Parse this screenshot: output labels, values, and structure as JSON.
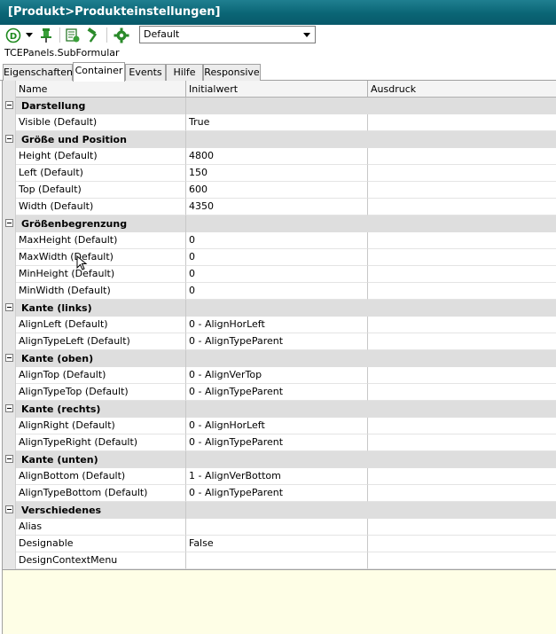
{
  "window": {
    "title": "[Produkt>Produkteinstellungen]"
  },
  "toolbar": {
    "icons": [
      "d-circle-icon",
      "dropdown-arrow-icon",
      "pin-icon",
      "form-list-icon",
      "hammer-icon",
      "gear-icon"
    ],
    "design_select": "Default",
    "accent": "#0a6575"
  },
  "component_path": "TCEPanels.SubFormular",
  "tabs": [
    "Eigenschaften",
    "Container",
    "Events",
    "Hilfe",
    "Responsive"
  ],
  "active_tab": "Container",
  "grid": {
    "columns": [
      "Name",
      "Initialwert",
      "Ausdruck"
    ],
    "categories": [
      {
        "title": "Darstellung",
        "rows": [
          {
            "name": "Visible (Default)",
            "value": "True",
            "expr": ""
          }
        ]
      },
      {
        "title": "Größe und Position",
        "rows": [
          {
            "name": "Height (Default)",
            "value": "4800",
            "expr": ""
          },
          {
            "name": "Left (Default)",
            "value": "150",
            "expr": ""
          },
          {
            "name": "Top (Default)",
            "value": "600",
            "expr": ""
          },
          {
            "name": "Width (Default)",
            "value": "4350",
            "expr": ""
          }
        ]
      },
      {
        "title": "Größenbegrenzung",
        "rows": [
          {
            "name": "MaxHeight (Default)",
            "value": "0",
            "expr": ""
          },
          {
            "name": "MaxWidth (Default)",
            "value": "0",
            "expr": ""
          },
          {
            "name": "MinHeight (Default)",
            "value": "0",
            "expr": ""
          },
          {
            "name": "MinWidth (Default)",
            "value": "0",
            "expr": ""
          }
        ]
      },
      {
        "title": "Kante (links)",
        "rows": [
          {
            "name": "AlignLeft (Default)",
            "value": "0 - AlignHorLeft",
            "expr": ""
          },
          {
            "name": "AlignTypeLeft (Default)",
            "value": "0 - AlignTypeParent",
            "expr": ""
          }
        ]
      },
      {
        "title": "Kante (oben)",
        "rows": [
          {
            "name": "AlignTop (Default)",
            "value": "0 - AlignVerTop",
            "expr": ""
          },
          {
            "name": "AlignTypeTop (Default)",
            "value": "0 - AlignTypeParent",
            "expr": ""
          }
        ]
      },
      {
        "title": "Kante (rechts)",
        "rows": [
          {
            "name": "AlignRight (Default)",
            "value": "0 - AlignHorLeft",
            "expr": ""
          },
          {
            "name": "AlignTypeRight (Default)",
            "value": "0 - AlignTypeParent",
            "expr": ""
          }
        ]
      },
      {
        "title": "Kante (unten)",
        "rows": [
          {
            "name": "AlignBottom (Default)",
            "value": "1 - AlignVerBottom",
            "expr": ""
          },
          {
            "name": "AlignTypeBottom (Default)",
            "value": "0 - AlignTypeParent",
            "expr": ""
          }
        ]
      },
      {
        "title": "Verschiedenes",
        "rows": [
          {
            "name": "Alias",
            "value": "",
            "expr": ""
          },
          {
            "name": "Designable",
            "value": "False",
            "expr": ""
          },
          {
            "name": "DesignContextMenu",
            "value": "",
            "expr": ""
          }
        ]
      }
    ]
  }
}
